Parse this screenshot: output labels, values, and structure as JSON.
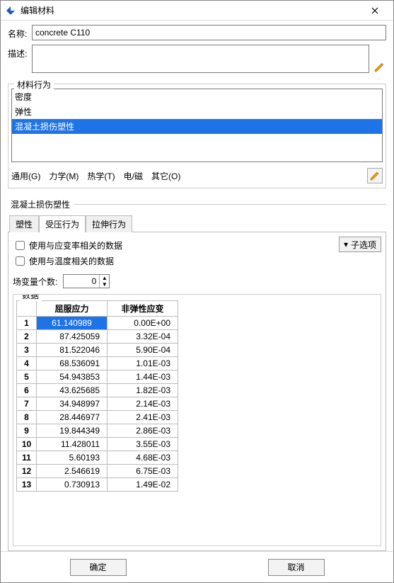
{
  "window": {
    "title": "编辑材料"
  },
  "labels": {
    "name": "名称:",
    "desc": "描述:"
  },
  "name_value": "concrete C110",
  "desc_value": "",
  "behavior_group_title": "材料行为",
  "behavior_items": [
    {
      "label": "密度",
      "selected": false
    },
    {
      "label": "弹性",
      "selected": false
    },
    {
      "label": "混凝土损伤塑性",
      "selected": true
    }
  ],
  "menus": {
    "general": "通用(G)",
    "mech": "力学(M)",
    "thermal": "热学(T)",
    "em": "电/磁",
    "other": "其它(O)"
  },
  "section_title": "混凝土损伤塑性",
  "tabs": [
    {
      "label": "塑性",
      "active": false
    },
    {
      "label": "受压行为",
      "active": true
    },
    {
      "label": "拉伸行为",
      "active": false
    }
  ],
  "options": {
    "strain_rate": "使用与应变率相关的数据",
    "temperature": "使用与温度相关的数据",
    "sub_options": "子选项",
    "field_vars_label": "场变量个数:",
    "field_vars_value": "0"
  },
  "data_group_title": "数据",
  "columns": {
    "stress": "屈服应力",
    "strain": "非弹性应变"
  },
  "rows": [
    {
      "n": "1",
      "stress": "61.140989",
      "strain": "0.00E+00",
      "selected": true
    },
    {
      "n": "2",
      "stress": "87.425059",
      "strain": "3.32E-04"
    },
    {
      "n": "3",
      "stress": "81.522046",
      "strain": "5.90E-04"
    },
    {
      "n": "4",
      "stress": "68.536091",
      "strain": "1.01E-03"
    },
    {
      "n": "5",
      "stress": "54.943853",
      "strain": "1.44E-03"
    },
    {
      "n": "6",
      "stress": "43.625685",
      "strain": "1.82E-03"
    },
    {
      "n": "7",
      "stress": "34.948997",
      "strain": "2.14E-03"
    },
    {
      "n": "8",
      "stress": "28.446977",
      "strain": "2.41E-03"
    },
    {
      "n": "9",
      "stress": "19.844349",
      "strain": "2.86E-03"
    },
    {
      "n": "10",
      "stress": "11.428011",
      "strain": "3.55E-03"
    },
    {
      "n": "11",
      "stress": "5.60193",
      "strain": "4.68E-03"
    },
    {
      "n": "12",
      "stress": "2.546619",
      "strain": "6.75E-03"
    },
    {
      "n": "13",
      "stress": "0.730913",
      "strain": "1.49E-02"
    }
  ],
  "footer": {
    "ok": "确定",
    "cancel": "取消"
  }
}
